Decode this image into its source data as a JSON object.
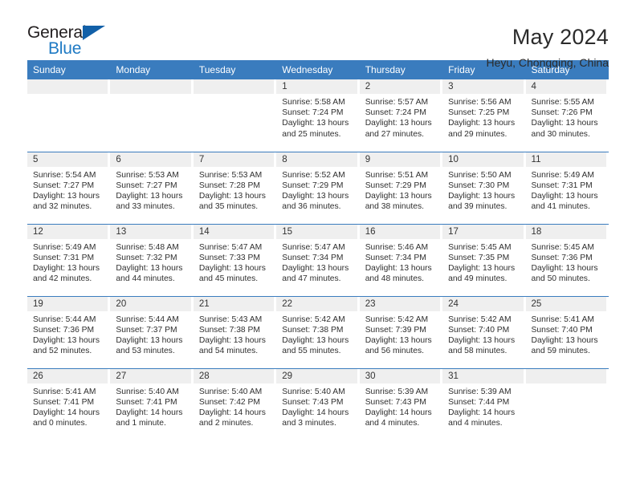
{
  "brand": {
    "word_one": "General",
    "word_two": "Blue"
  },
  "header": {
    "title": "May 2024",
    "location": "Heyu, Chongqing, China"
  },
  "colors": {
    "header_blue": "#3a7cbe",
    "logo_blue": "#1f7ac4",
    "logo_triangle": "#1260a8",
    "daynum_background": "#efefef"
  },
  "weekdays": [
    "Sunday",
    "Monday",
    "Tuesday",
    "Wednesday",
    "Thursday",
    "Friday",
    "Saturday"
  ],
  "weeks": [
    [
      {
        "day": "",
        "lines": []
      },
      {
        "day": "",
        "lines": []
      },
      {
        "day": "",
        "lines": []
      },
      {
        "day": "1",
        "lines": [
          "Sunrise: 5:58 AM",
          "Sunset: 7:24 PM",
          "Daylight: 13 hours",
          "and 25 minutes."
        ]
      },
      {
        "day": "2",
        "lines": [
          "Sunrise: 5:57 AM",
          "Sunset: 7:24 PM",
          "Daylight: 13 hours",
          "and 27 minutes."
        ]
      },
      {
        "day": "3",
        "lines": [
          "Sunrise: 5:56 AM",
          "Sunset: 7:25 PM",
          "Daylight: 13 hours",
          "and 29 minutes."
        ]
      },
      {
        "day": "4",
        "lines": [
          "Sunrise: 5:55 AM",
          "Sunset: 7:26 PM",
          "Daylight: 13 hours",
          "and 30 minutes."
        ]
      }
    ],
    [
      {
        "day": "5",
        "lines": [
          "Sunrise: 5:54 AM",
          "Sunset: 7:27 PM",
          "Daylight: 13 hours",
          "and 32 minutes."
        ]
      },
      {
        "day": "6",
        "lines": [
          "Sunrise: 5:53 AM",
          "Sunset: 7:27 PM",
          "Daylight: 13 hours",
          "and 33 minutes."
        ]
      },
      {
        "day": "7",
        "lines": [
          "Sunrise: 5:53 AM",
          "Sunset: 7:28 PM",
          "Daylight: 13 hours",
          "and 35 minutes."
        ]
      },
      {
        "day": "8",
        "lines": [
          "Sunrise: 5:52 AM",
          "Sunset: 7:29 PM",
          "Daylight: 13 hours",
          "and 36 minutes."
        ]
      },
      {
        "day": "9",
        "lines": [
          "Sunrise: 5:51 AM",
          "Sunset: 7:29 PM",
          "Daylight: 13 hours",
          "and 38 minutes."
        ]
      },
      {
        "day": "10",
        "lines": [
          "Sunrise: 5:50 AM",
          "Sunset: 7:30 PM",
          "Daylight: 13 hours",
          "and 39 minutes."
        ]
      },
      {
        "day": "11",
        "lines": [
          "Sunrise: 5:49 AM",
          "Sunset: 7:31 PM",
          "Daylight: 13 hours",
          "and 41 minutes."
        ]
      }
    ],
    [
      {
        "day": "12",
        "lines": [
          "Sunrise: 5:49 AM",
          "Sunset: 7:31 PM",
          "Daylight: 13 hours",
          "and 42 minutes."
        ]
      },
      {
        "day": "13",
        "lines": [
          "Sunrise: 5:48 AM",
          "Sunset: 7:32 PM",
          "Daylight: 13 hours",
          "and 44 minutes."
        ]
      },
      {
        "day": "14",
        "lines": [
          "Sunrise: 5:47 AM",
          "Sunset: 7:33 PM",
          "Daylight: 13 hours",
          "and 45 minutes."
        ]
      },
      {
        "day": "15",
        "lines": [
          "Sunrise: 5:47 AM",
          "Sunset: 7:34 PM",
          "Daylight: 13 hours",
          "and 47 minutes."
        ]
      },
      {
        "day": "16",
        "lines": [
          "Sunrise: 5:46 AM",
          "Sunset: 7:34 PM",
          "Daylight: 13 hours",
          "and 48 minutes."
        ]
      },
      {
        "day": "17",
        "lines": [
          "Sunrise: 5:45 AM",
          "Sunset: 7:35 PM",
          "Daylight: 13 hours",
          "and 49 minutes."
        ]
      },
      {
        "day": "18",
        "lines": [
          "Sunrise: 5:45 AM",
          "Sunset: 7:36 PM",
          "Daylight: 13 hours",
          "and 50 minutes."
        ]
      }
    ],
    [
      {
        "day": "19",
        "lines": [
          "Sunrise: 5:44 AM",
          "Sunset: 7:36 PM",
          "Daylight: 13 hours",
          "and 52 minutes."
        ]
      },
      {
        "day": "20",
        "lines": [
          "Sunrise: 5:44 AM",
          "Sunset: 7:37 PM",
          "Daylight: 13 hours",
          "and 53 minutes."
        ]
      },
      {
        "day": "21",
        "lines": [
          "Sunrise: 5:43 AM",
          "Sunset: 7:38 PM",
          "Daylight: 13 hours",
          "and 54 minutes."
        ]
      },
      {
        "day": "22",
        "lines": [
          "Sunrise: 5:42 AM",
          "Sunset: 7:38 PM",
          "Daylight: 13 hours",
          "and 55 minutes."
        ]
      },
      {
        "day": "23",
        "lines": [
          "Sunrise: 5:42 AM",
          "Sunset: 7:39 PM",
          "Daylight: 13 hours",
          "and 56 minutes."
        ]
      },
      {
        "day": "24",
        "lines": [
          "Sunrise: 5:42 AM",
          "Sunset: 7:40 PM",
          "Daylight: 13 hours",
          "and 58 minutes."
        ]
      },
      {
        "day": "25",
        "lines": [
          "Sunrise: 5:41 AM",
          "Sunset: 7:40 PM",
          "Daylight: 13 hours",
          "and 59 minutes."
        ]
      }
    ],
    [
      {
        "day": "26",
        "lines": [
          "Sunrise: 5:41 AM",
          "Sunset: 7:41 PM",
          "Daylight: 14 hours",
          "and 0 minutes."
        ]
      },
      {
        "day": "27",
        "lines": [
          "Sunrise: 5:40 AM",
          "Sunset: 7:41 PM",
          "Daylight: 14 hours",
          "and 1 minute."
        ]
      },
      {
        "day": "28",
        "lines": [
          "Sunrise: 5:40 AM",
          "Sunset: 7:42 PM",
          "Daylight: 14 hours",
          "and 2 minutes."
        ]
      },
      {
        "day": "29",
        "lines": [
          "Sunrise: 5:40 AM",
          "Sunset: 7:43 PM",
          "Daylight: 14 hours",
          "and 3 minutes."
        ]
      },
      {
        "day": "30",
        "lines": [
          "Sunrise: 5:39 AM",
          "Sunset: 7:43 PM",
          "Daylight: 14 hours",
          "and 4 minutes."
        ]
      },
      {
        "day": "31",
        "lines": [
          "Sunrise: 5:39 AM",
          "Sunset: 7:44 PM",
          "Daylight: 14 hours",
          "and 4 minutes."
        ]
      },
      {
        "day": "",
        "lines": []
      }
    ]
  ]
}
